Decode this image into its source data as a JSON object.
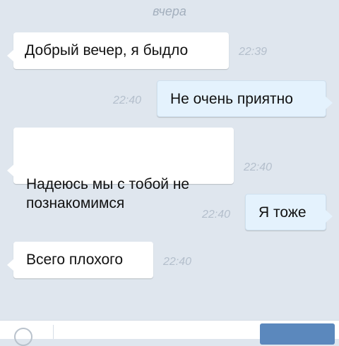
{
  "chat": {
    "day_label": "вчера",
    "messages": [
      {
        "direction": "in",
        "text": "Добрый вечер, я быдло",
        "time": "22:39"
      },
      {
        "direction": "out",
        "text": "Не очень приятно",
        "time": "22:40"
      },
      {
        "direction": "in",
        "text": "Надеюсь мы с тобой не\nпознакомимся",
        "time": "22:40"
      },
      {
        "direction": "out",
        "text": "Я тоже",
        "time": "22:40"
      },
      {
        "direction": "in",
        "text": "Всего плохого",
        "time": "22:40"
      }
    ]
  },
  "composer": {
    "emoji_icon": "smile-icon",
    "placeholder": "",
    "send_label": ""
  },
  "colors": {
    "background": "#dfe6ee",
    "incoming_bubble": "#ffffff",
    "outgoing_bubble": "#e4f2fd",
    "timestamp": "#b4bfcc",
    "send_button": "#5b88bd"
  }
}
